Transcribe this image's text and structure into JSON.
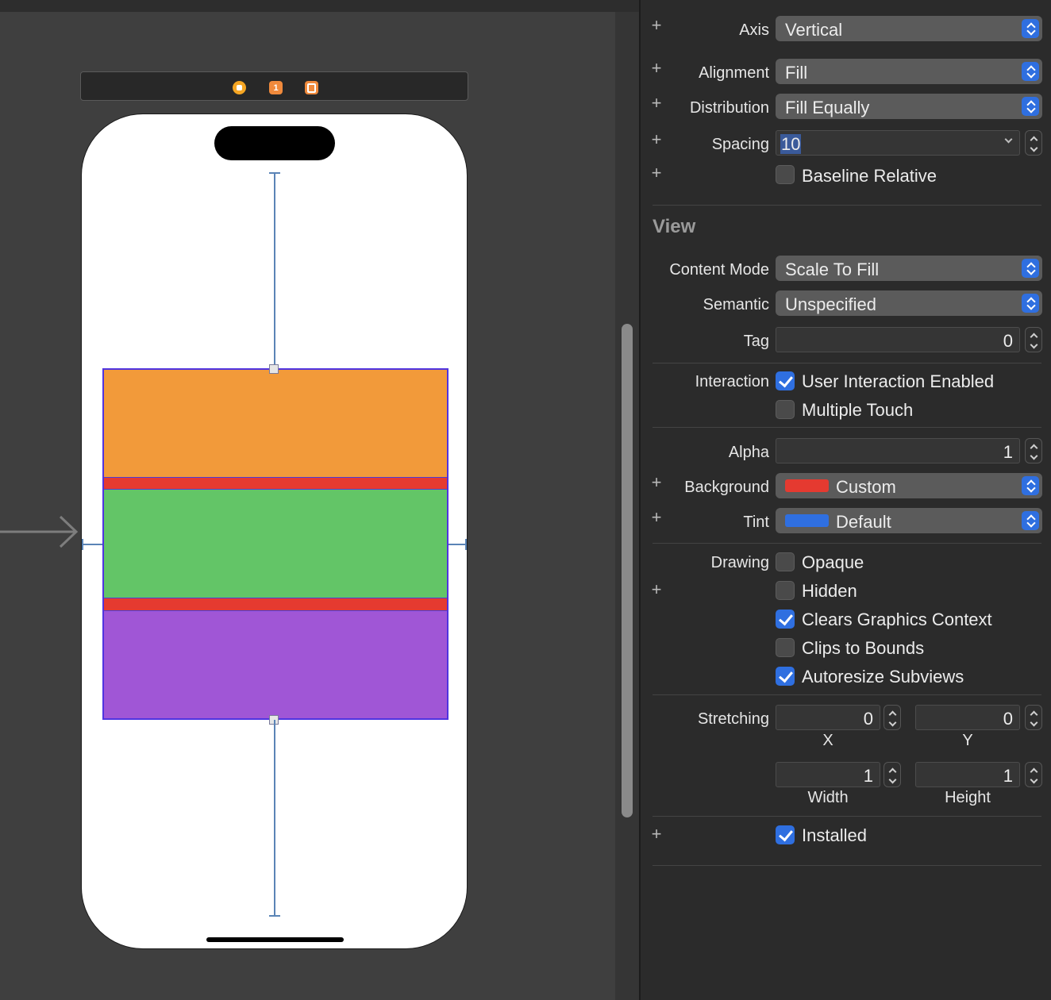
{
  "canvas": {
    "scene_dock": {
      "first_responder_badge": "1"
    }
  },
  "inspector": {
    "stack_view": {
      "axis": {
        "label": "Axis",
        "value": "Vertical"
      },
      "alignment": {
        "label": "Alignment",
        "value": "Fill"
      },
      "distribution": {
        "label": "Distribution",
        "value": "Fill Equally"
      },
      "spacing": {
        "label": "Spacing",
        "value": "10"
      },
      "baseline_relative": {
        "label": "Baseline Relative",
        "checked": false
      }
    },
    "view": {
      "header": "View",
      "content_mode": {
        "label": "Content Mode",
        "value": "Scale To Fill"
      },
      "semantic": {
        "label": "Semantic",
        "value": "Unspecified"
      },
      "tag": {
        "label": "Tag",
        "value": "0"
      },
      "interaction": {
        "label": "Interaction",
        "user_interaction_enabled": {
          "label": "User Interaction Enabled",
          "checked": true
        },
        "multiple_touch": {
          "label": "Multiple Touch",
          "checked": false
        }
      },
      "alpha": {
        "label": "Alpha",
        "value": "1"
      },
      "background": {
        "label": "Background",
        "value": "Custom",
        "color": "#e53a30"
      },
      "tint": {
        "label": "Tint",
        "value": "Default",
        "color": "#2f6fe0"
      },
      "drawing": {
        "label": "Drawing",
        "opaque": {
          "label": "Opaque",
          "checked": false
        },
        "hidden": {
          "label": "Hidden",
          "checked": false
        },
        "clears_graphics_context": {
          "label": "Clears Graphics Context",
          "checked": true
        },
        "clips_to_bounds": {
          "label": "Clips to Bounds",
          "checked": false
        },
        "autoresize_subviews": {
          "label": "Autoresize Subviews",
          "checked": true
        }
      },
      "stretching": {
        "label": "Stretching",
        "x": {
          "label": "X",
          "value": "0"
        },
        "y": {
          "label": "Y",
          "value": "0"
        },
        "width": {
          "label": "Width",
          "value": "1"
        },
        "height": {
          "label": "Height",
          "value": "1"
        }
      },
      "installed": {
        "label": "Installed",
        "checked": true
      }
    }
  },
  "colors": {
    "orange_view": "#f29a3a",
    "green_view": "#63c567",
    "purple_view": "#a056d6",
    "stack_background": "#e53a30",
    "accent": "#2f6fe0"
  }
}
